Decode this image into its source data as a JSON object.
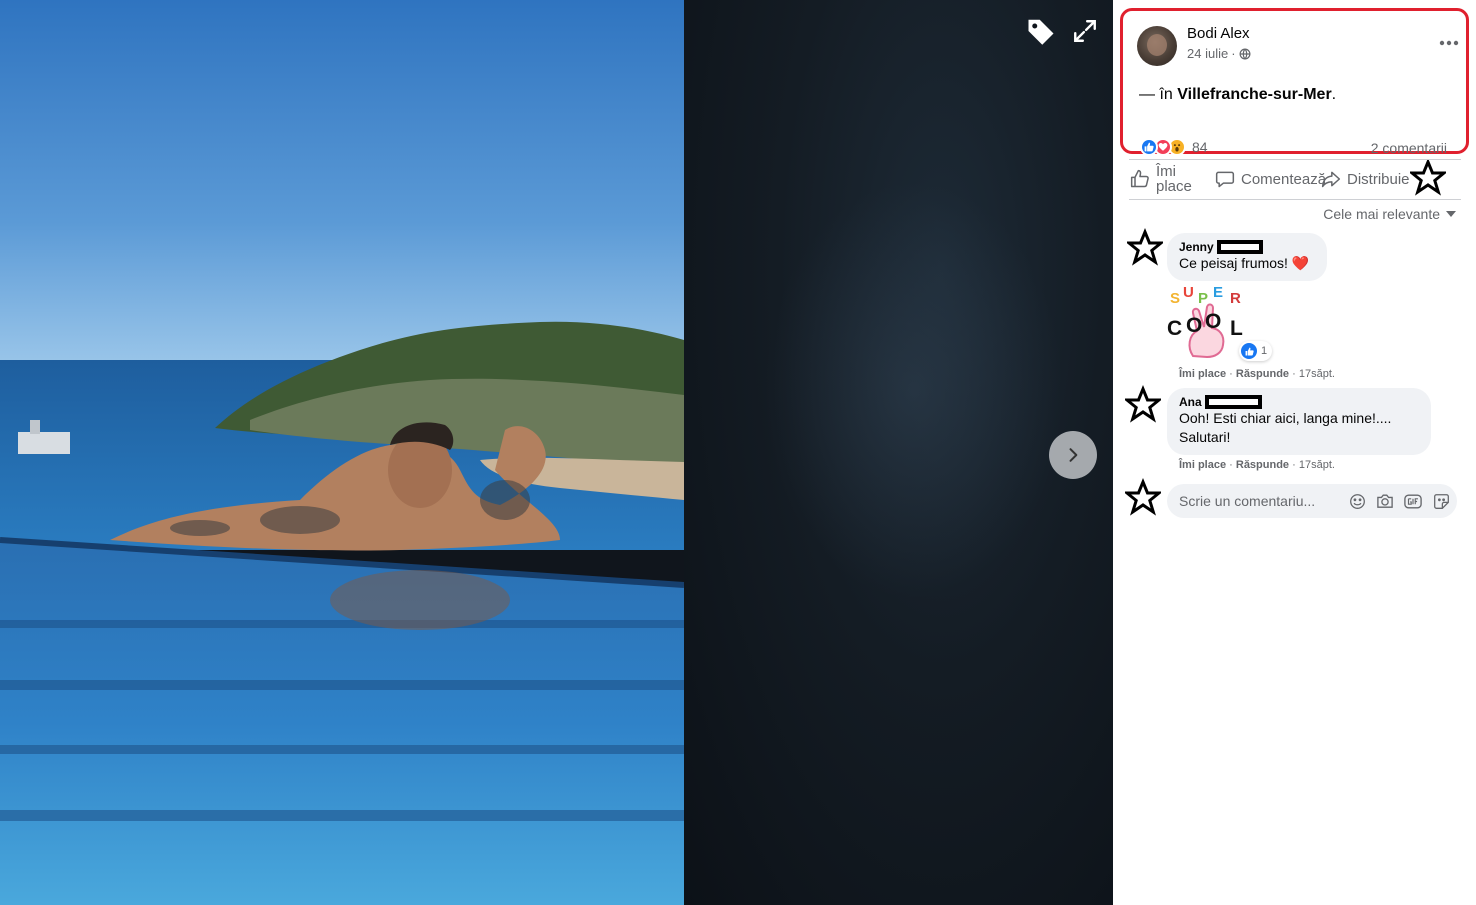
{
  "post": {
    "author": "Bodi Alex",
    "date": "24 iulie",
    "separator": "·",
    "text_prefix": "— în",
    "place": "Villefranche-sur-Mer",
    "text_suffix": ".",
    "reaction_count": "84",
    "comment_count": "2 comentarii"
  },
  "actions": {
    "like": "Îmi place",
    "comment": "Comentează",
    "share": "Distribuie"
  },
  "sort_label": "Cele mai relevante",
  "comments": [
    {
      "name": "Jenny",
      "text": "Ce peisaj frumos! ❤️",
      "sticker_letters": [
        "S",
        "U",
        "P",
        "E",
        "R",
        "C",
        "O",
        "O",
        "L"
      ],
      "sticker_like_count": "1",
      "like_label": "Îmi place",
      "reply_label": "Răspunde",
      "time": "17săpt.",
      "dot": "·"
    },
    {
      "name": "Ana",
      "text": "Ooh! Esti chiar aici, langa mine!.... Salutari!",
      "like_label": "Îmi place",
      "reply_label": "Răspunde",
      "time": "17săpt.",
      "dot": "·"
    }
  ],
  "comment_input": {
    "placeholder": "Scrie un comentariu..."
  },
  "colors": {
    "highlight_box": "#e0202e",
    "like_blue": "#1877f2",
    "love_red": "#f33e58",
    "wow_yellow": "#f7b125",
    "secondary_text": "#65676b"
  },
  "icons": [
    "tag-icon",
    "expand-icon",
    "chevron-right-icon",
    "globe-icon",
    "more-icon",
    "thumbs-up-icon",
    "comment-icon",
    "share-icon",
    "star-icon",
    "caret-down-icon",
    "emoji-icon",
    "camera-icon",
    "gif-icon",
    "sticker-icon"
  ]
}
